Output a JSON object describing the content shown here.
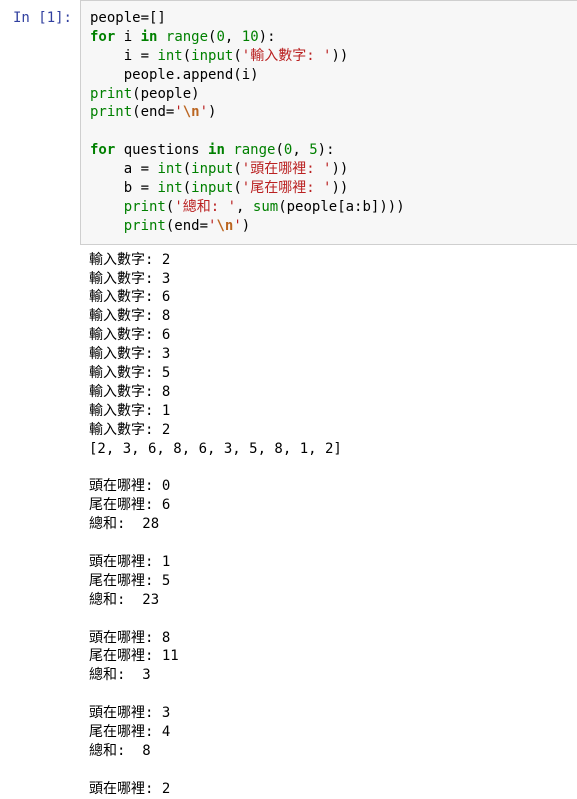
{
  "prompt_label": "In [1]:",
  "code": {
    "l1_people": "people",
    "l1_eq": "=[]",
    "kw_for": "for",
    "kw_in": "in",
    "kw_range": "range",
    "kw_int": "int",
    "kw_input": "input",
    "kw_print": "print",
    "kw_sum": "sum",
    "var_i": " i ",
    "num_0": "0",
    "num_10": "10",
    "num_5": "5",
    "close_paren_colon": "):",
    "indent_i_eq": "    i = ",
    "open_paren": "(",
    "close_paren": ")",
    "double_close": "))",
    "triple_close": ")))",
    "str_input_num": "'輸入數字: '",
    "indent_people_append": "    people.append(i)",
    "arg_people": "(people)",
    "arg_end_eq": "(end=",
    "str_newline_open": "'",
    "str_newline_esc": "\\n",
    "str_newline_close": "'",
    "var_questions": " questions ",
    "indent_a_eq": "    a = ",
    "indent_b_eq": "    b = ",
    "str_head": "'頭在哪裡: '",
    "str_tail": "'尾在哪裡: '",
    "str_sum": "'總和: '",
    "comma_sp": ", ",
    "slice": "(people[a:b])))",
    "indent2_print": "    ",
    "indent1_print": ""
  },
  "output_text": "輸入數字: 2\n輸入數字: 3\n輸入數字: 6\n輸入數字: 8\n輸入數字: 6\n輸入數字: 3\n輸入數字: 5\n輸入數字: 8\n輸入數字: 1\n輸入數字: 2\n[2, 3, 6, 8, 6, 3, 5, 8, 1, 2]\n\n頭在哪裡: 0\n尾在哪裡: 6\n總和:  28\n\n頭在哪裡: 1\n尾在哪裡: 5\n總和:  23\n\n頭在哪裡: 8\n尾在哪裡: 11\n總和:  3\n\n頭在哪裡: 3\n尾在哪裡: 4\n總和:  8\n\n頭在哪裡: 2"
}
